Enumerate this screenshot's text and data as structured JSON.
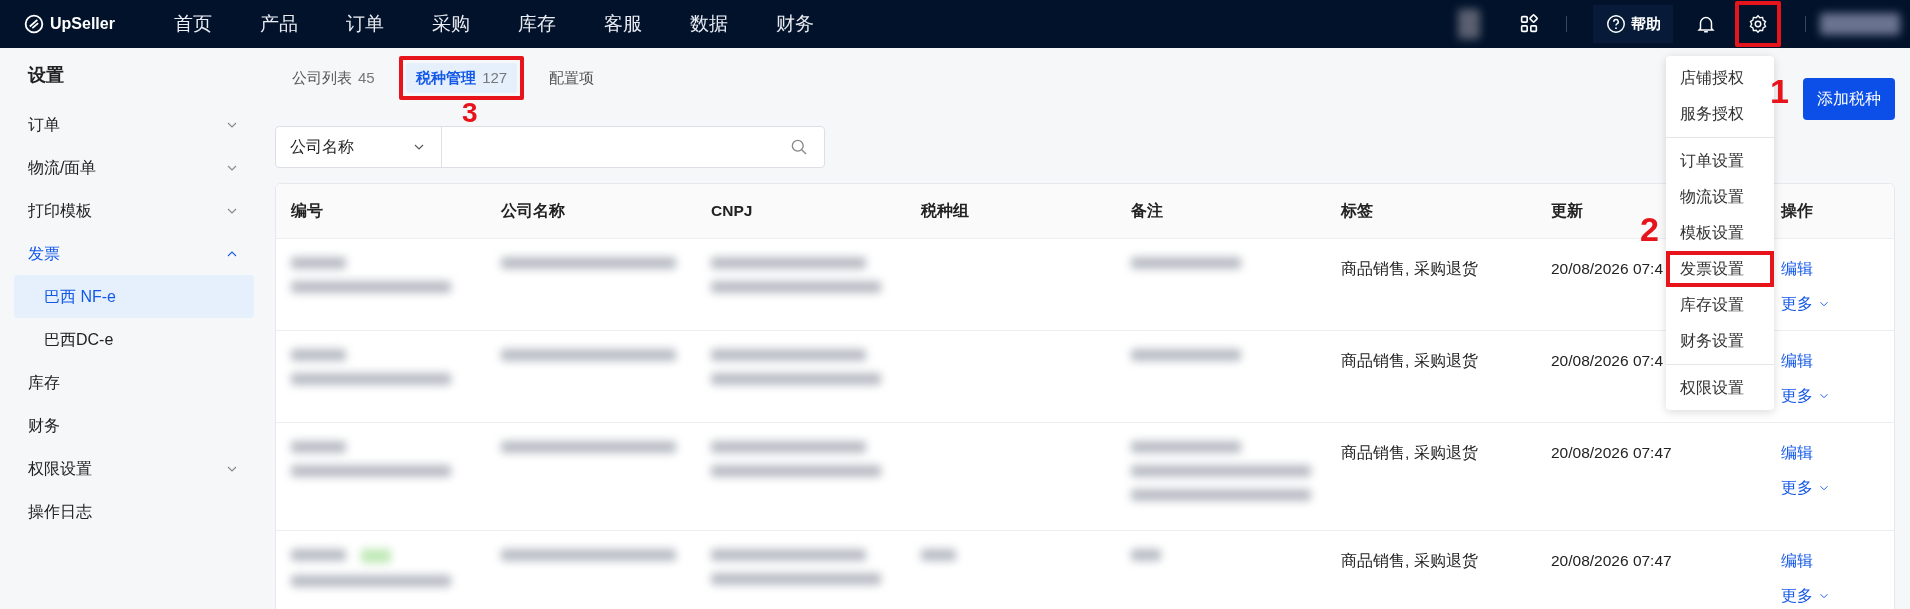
{
  "topbar": {
    "logo": "UpSeller",
    "nav": [
      {
        "label": "首页"
      },
      {
        "label": "产品"
      },
      {
        "label": "订单"
      },
      {
        "label": "采购"
      },
      {
        "label": "库存"
      },
      {
        "label": "客服"
      },
      {
        "label": "数据"
      },
      {
        "label": "财务"
      }
    ],
    "help": "帮助",
    "settings_highlighted": true
  },
  "sidebar": {
    "title": "设置",
    "items": [
      {
        "label": "订单",
        "kind": "group",
        "expanded": false
      },
      {
        "label": "物流/面单",
        "kind": "group",
        "expanded": false
      },
      {
        "label": "打印模板",
        "kind": "group",
        "expanded": false
      },
      {
        "label": "发票",
        "kind": "group",
        "expanded": true,
        "children": [
          {
            "label": "巴西 NF-e",
            "selected": true
          },
          {
            "label": "巴西DC-e",
            "selected": false
          }
        ]
      },
      {
        "label": "库存",
        "kind": "link"
      },
      {
        "label": "财务",
        "kind": "link"
      },
      {
        "label": "权限设置",
        "kind": "group",
        "expanded": false
      },
      {
        "label": "操作日志",
        "kind": "link"
      }
    ]
  },
  "tabs": [
    {
      "label": "公司列表",
      "count": "45",
      "selected": false,
      "highlighted": false
    },
    {
      "label": "税种管理",
      "count": "127",
      "selected": true,
      "highlighted": true
    },
    {
      "label": "配置项",
      "selected": false,
      "highlighted": false
    }
  ],
  "search": {
    "field": "公司名称"
  },
  "add_button": "添加税种",
  "table": {
    "columns": [
      "编号",
      "公司名称",
      "CNPJ",
      "税种组",
      "备注",
      "标签",
      "更新",
      "操作"
    ],
    "rows": [
      {
        "tags": "商品销售, 采购退货",
        "updated": "20/08/2026 07:4",
        "actions": [
          "编辑",
          "更多"
        ]
      },
      {
        "tags": "商品销售, 采购退货",
        "updated": "20/08/2026 07:4",
        "actions": [
          "编辑",
          "更多"
        ]
      },
      {
        "tags": "商品销售, 采购退货",
        "updated": "20/08/2026 07:47",
        "actions": [
          "编辑",
          "更多"
        ]
      },
      {
        "tags": "商品销售, 采购退货",
        "updated": "20/08/2026 07:47",
        "actions": [
          "编辑",
          "更多"
        ]
      }
    ]
  },
  "settings_menu": {
    "groups": [
      {
        "items": [
          {
            "label": "店铺授权",
            "highlighted": false
          },
          {
            "label": "服务授权",
            "highlighted": false
          }
        ]
      },
      {
        "items": [
          {
            "label": "订单设置",
            "highlighted": false
          },
          {
            "label": "物流设置",
            "highlighted": false
          },
          {
            "label": "模板设置",
            "highlighted": false
          },
          {
            "label": "发票设置",
            "highlighted": true
          },
          {
            "label": "库存设置",
            "highlighted": false
          },
          {
            "label": "财务设置",
            "highlighted": false
          }
        ]
      },
      {
        "items": [
          {
            "label": "权限设置",
            "highlighted": false
          }
        ]
      }
    ]
  },
  "annotations": [
    {
      "label": "1"
    },
    {
      "label": "2"
    },
    {
      "label": "3"
    }
  ]
}
